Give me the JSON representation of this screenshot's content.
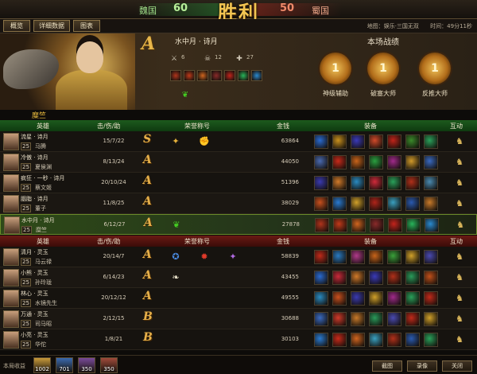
{
  "top": {
    "left_kingdom": "魏国",
    "left_score": "60",
    "right_kingdom": "蜀国",
    "right_score": "50",
    "result_label": "胜利"
  },
  "tabs": [
    "概览",
    "详细数据",
    "图表"
  ],
  "info": {
    "map_label": "地图：娱乐·三国无双",
    "time_label": "时间：",
    "time_value": "49分11秒"
  },
  "summary": {
    "grade": "A",
    "player_name": "水中月 · 诗月",
    "stats": [
      {
        "icon": "kill-icon",
        "value": "6"
      },
      {
        "icon": "death-icon",
        "value": "12"
      },
      {
        "icon": "assist-icon",
        "value": "27"
      }
    ],
    "skill_colors": [
      "#b0341c",
      "#c03a1a",
      "#d0651f",
      "#8a2a2a",
      "#c4241c",
      "#28b45a",
      "#2a8ad0"
    ],
    "battle_title": "本场战绩",
    "medals": [
      {
        "number": "1",
        "label": "神级辅助"
      },
      {
        "number": "1",
        "label": "破塞大师"
      },
      {
        "number": "1",
        "label": "反推大师"
      }
    ]
  },
  "team_name": "糜竺",
  "headers": {
    "hero": "英雄",
    "kda": "击/伤/助",
    "honor": "荣誉称号",
    "gold": "金钱",
    "equip": "装备",
    "interact": "互动"
  },
  "team_a": [
    {
      "player": "流星 · 诗月",
      "level": "25",
      "hero": "马腾",
      "kda": "15/7/22",
      "grade": "S",
      "honors": [
        {
          "icon": "gold-medal-icon",
          "color": "#e5b13a",
          "glyph": "✦"
        },
        {
          "icon": "fist-icon",
          "color": "#f3e6c0",
          "glyph": "✊"
        }
      ],
      "gold": "63864",
      "equips": [
        "#2a6ad0",
        "#c8901e",
        "#3a3ab8",
        "#d04a2a",
        "#c0241a",
        "#3a8a2a",
        "#2aa05a"
      ]
    },
    {
      "player": "冷傲 · 诗月",
      "level": "25",
      "hero": "夏侯渊",
      "kda": "8/13/24",
      "grade": "A",
      "honors": [],
      "gold": "44050",
      "equips": [
        "#4a6ab0",
        "#c82a1a",
        "#c8641a",
        "#2aa040",
        "#a02a8a",
        "#d09a2a",
        "#3a6ac0"
      ]
    },
    {
      "player": "疯狂 · 一秒 · 诗月",
      "level": "25",
      "hero": "蔡文姬",
      "kda": "20/10/24",
      "grade": "A",
      "honors": [],
      "gold": "51396",
      "equips": [
        "#3a3ab0",
        "#d07a2a",
        "#2a8ac0",
        "#d02a3a",
        "#2aa05a",
        "#b0301a",
        "#4a8ab0"
      ]
    },
    {
      "player": "胭脂 · 诗月",
      "level": "25",
      "hero": "董子",
      "kda": "11/8/25",
      "grade": "A",
      "honors": [],
      "gold": "38029",
      "equips": [
        "#c8501e",
        "#2a7ad0",
        "#d0a02a",
        "#b0241a",
        "#3aa0c0",
        "#2a5ab0",
        "#c87a2a"
      ]
    },
    {
      "player": "水中月 · 诗月",
      "level": "25",
      "hero": "糜竺",
      "kda": "6/12/27",
      "grade": "A",
      "honors": [
        {
          "icon": "green-leaf-icon",
          "color": "#44cc22",
          "glyph": "❦"
        }
      ],
      "gold": "27878",
      "equips": [
        "#b0341c",
        "#c03a1a",
        "#d0651f",
        "#8a2a2a",
        "#c4241c",
        "#28b45a",
        "#2a8ad0"
      ],
      "self": true
    }
  ],
  "team_b": [
    {
      "player": "清月 · 灵玉",
      "level": "25",
      "hero": "马云禄",
      "kda": "20/14/7",
      "grade": "A",
      "honors": [
        {
          "icon": "blue-crest-icon",
          "color": "#4a8ae0",
          "glyph": "✪"
        },
        {
          "icon": "red-seal-icon",
          "color": "#e03a2a",
          "glyph": "✹"
        },
        {
          "icon": "purple-crest-icon",
          "color": "#b06ae0",
          "glyph": "✦"
        }
      ],
      "gold": "58839",
      "equips": [
        "#c02a1a",
        "#2a7ac0",
        "#b03a8a",
        "#c8641a",
        "#3aa03a",
        "#d0a02a",
        "#4a4ab0"
      ]
    },
    {
      "player": "小熊 · 灵玉",
      "level": "25",
      "hero": "孙玲珑",
      "kda": "6/14/23",
      "grade": "A",
      "honors": [
        {
          "icon": "wing-icon",
          "color": "#e8e0c8",
          "glyph": "❧"
        }
      ],
      "gold": "43455",
      "equips": [
        "#2a6ad0",
        "#c82a3a",
        "#d07a2a",
        "#3a3ab8",
        "#b0301a",
        "#2a9a5a",
        "#c0501a"
      ]
    },
    {
      "player": "林心 · 灵玉",
      "level": "25",
      "hero": "水镜先生",
      "kda": "20/12/12",
      "grade": "A",
      "honors": [],
      "gold": "49555",
      "equips": [
        "#2a8ac0",
        "#c8501e",
        "#3a3ab0",
        "#d0a02a",
        "#a02a8a",
        "#2aa05a",
        "#c02a1a"
      ]
    },
    {
      "player": "万通 · 灵玉",
      "level": "25",
      "hero": "司马昭",
      "kda": "2/12/15",
      "grade": "B",
      "honors": [],
      "gold": "30688",
      "equips": [
        "#3a6ac0",
        "#d03a2a",
        "#c87a2a",
        "#2a9a5a",
        "#4a4ab0",
        "#c02a1a",
        "#d0a02a"
      ]
    },
    {
      "player": "小亮 · 灵玉",
      "level": "25",
      "hero": "华佗",
      "kda": "1/8/21",
      "grade": "B",
      "honors": [],
      "gold": "30103",
      "equips": [
        "#2a7ad0",
        "#c82a1a",
        "#d0651f",
        "#3aa0c0",
        "#b0301a",
        "#2a5ab0",
        "#2aa05a"
      ]
    }
  ],
  "bottom": {
    "earn_label": "本局收益",
    "earnings": [
      {
        "icon": "gold-coin-icon",
        "value": "1002",
        "color": "#c89a3a"
      },
      {
        "icon": "blue-gem-icon",
        "value": "701",
        "color": "#3a6ab0"
      },
      {
        "icon": "exp-scroll-icon",
        "value": "350",
        "color": "#7a4a9a"
      },
      {
        "icon": "hero-card-icon",
        "value": "350",
        "color": "#a04a3a"
      }
    ],
    "buttons": [
      "截图",
      "录像",
      "关闭"
    ]
  }
}
